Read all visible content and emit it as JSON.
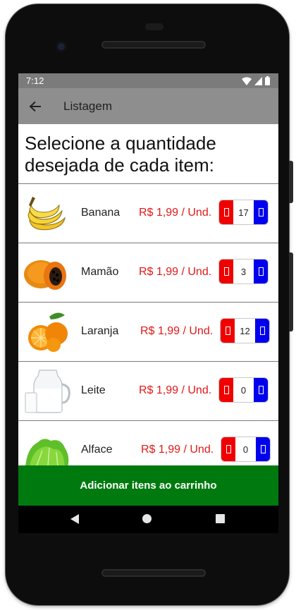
{
  "status_bar": {
    "time": "7:12",
    "icons": [
      "wifi-icon",
      "signal-icon",
      "battery-icon"
    ]
  },
  "app_bar": {
    "back_icon": "arrow-left-icon",
    "title": "Listagem"
  },
  "heading": "Selecione a quantidade desejada de cada item:",
  "items": [
    {
      "name": "Banana",
      "price": "R$ 1,99 / Und.",
      "quantity": "17",
      "image": "banana"
    },
    {
      "name": "Mamão",
      "price": "R$ 1,99 / Und.",
      "quantity": "3",
      "image": "papaya"
    },
    {
      "name": "Laranja",
      "price": "R$ 1,99 / Und.",
      "quantity": "12",
      "image": "orange"
    },
    {
      "name": "Leite",
      "price": "R$ 1,99 / Und.",
      "quantity": "0",
      "image": "milk"
    },
    {
      "name": "Alface",
      "price": "R$ 1,99 / Und.",
      "quantity": "0",
      "image": "lettuce"
    }
  ],
  "cta_label": "Adicionar itens ao carrinho",
  "colors": {
    "app_bar": "#8e8e8e",
    "price": "#e01818",
    "minus": "#f00000",
    "plus": "#0000ee",
    "cta": "#007a0e"
  }
}
